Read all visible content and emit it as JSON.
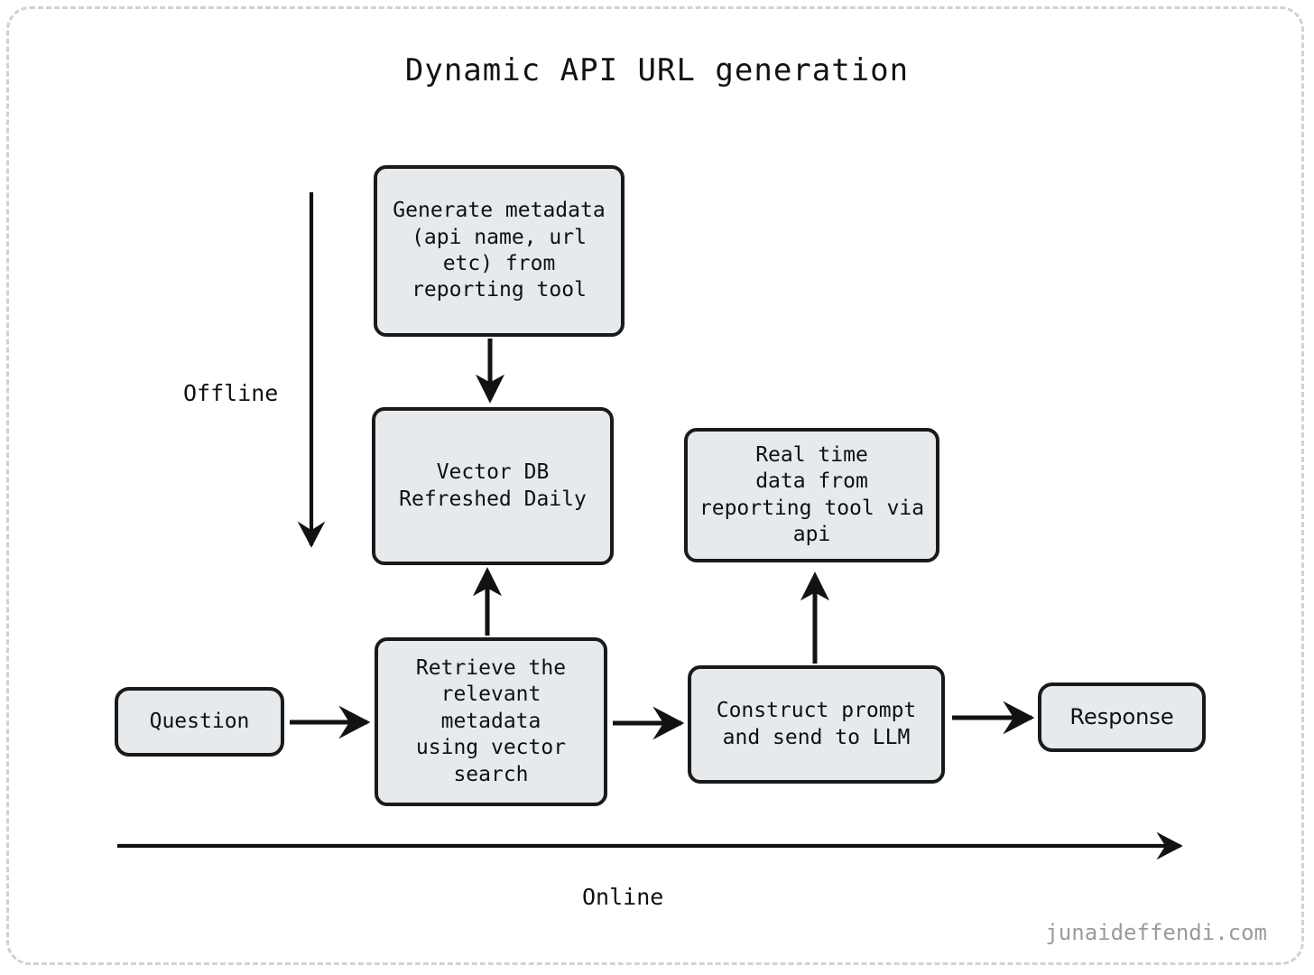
{
  "diagram": {
    "title": "Dynamic API URL generation",
    "watermark": "junaideffendi.com",
    "colors": {
      "node_fill": "#e7eaed",
      "node_border": "#1a1a1a",
      "edge": "#121212",
      "frame": "#cfd2d4",
      "watermark_text": "#9b9b9b",
      "background": "#ffffff"
    },
    "phase_labels": {
      "offline": "Offline",
      "online": "Online"
    },
    "nodes": {
      "generate_metadata": "Generate metadata\n(api name, url\netc) from\nreporting tool",
      "vector_db": "Vector DB\nRefreshed Daily",
      "realtime_data": "Real time\ndata from\nreporting tool via\napi",
      "retrieve": "Retrieve the\nrelevant\nmetadata\nusing vector\nsearch",
      "construct_prompt": "Construct prompt\nand send to LLM",
      "question": "Question",
      "response": "Response"
    },
    "edges": [
      {
        "name": "generate-metadata-to-vector-db",
        "from": "generate_metadata",
        "to": "vector_db",
        "direction": "down"
      },
      {
        "name": "retrieve-to-vector-db",
        "from": "retrieve",
        "to": "vector_db",
        "direction": "up"
      },
      {
        "name": "construct-prompt-to-realtime-data",
        "from": "construct_prompt",
        "to": "realtime_data",
        "direction": "up"
      },
      {
        "name": "question-to-retrieve",
        "from": "question",
        "to": "retrieve",
        "direction": "right"
      },
      {
        "name": "retrieve-to-construct-prompt",
        "from": "retrieve",
        "to": "construct_prompt",
        "direction": "right"
      },
      {
        "name": "construct-prompt-to-response",
        "from": "construct_prompt",
        "to": "response",
        "direction": "right"
      },
      {
        "name": "offline-phase-arrow",
        "from": "offline",
        "to": "offline",
        "direction": "down"
      },
      {
        "name": "online-phase-arrow",
        "from": "online",
        "to": "online",
        "direction": "right"
      }
    ]
  }
}
